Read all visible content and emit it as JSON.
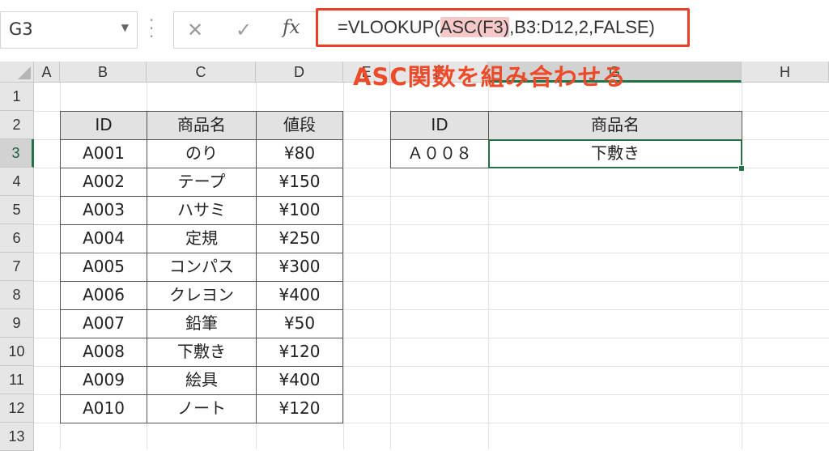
{
  "formula_bar": {
    "name_box": "G3",
    "cancel_icon": "close-icon",
    "enter_icon": "check-icon",
    "fx_label": "fx",
    "formula_prefix": "=VLOOKUP(",
    "formula_highlight": "ASC(F3)",
    "formula_suffix": ",B3:D12,2,FALSE)"
  },
  "annotation": "ASC関数を組み合わせる",
  "columns": [
    "A",
    "B",
    "C",
    "D",
    "E",
    "F",
    "G",
    "H"
  ],
  "rows": [
    "1",
    "2",
    "3",
    "4",
    "5",
    "6",
    "7",
    "8",
    "9",
    "10",
    "11",
    "12",
    "13"
  ],
  "product_table": {
    "headers": [
      "ID",
      "商品名",
      "値段"
    ],
    "rows": [
      [
        "A001",
        "のり",
        "¥80"
      ],
      [
        "A002",
        "テープ",
        "¥150"
      ],
      [
        "A003",
        "ハサミ",
        "¥100"
      ],
      [
        "A004",
        "定規",
        "¥250"
      ],
      [
        "A005",
        "コンパス",
        "¥300"
      ],
      [
        "A006",
        "クレヨン",
        "¥400"
      ],
      [
        "A007",
        "鉛筆",
        "¥50"
      ],
      [
        "A008",
        "下敷き",
        "¥120"
      ],
      [
        "A009",
        "絵具",
        "¥400"
      ],
      [
        "A010",
        "ノート",
        "¥120"
      ]
    ]
  },
  "lookup_table": {
    "headers": [
      "ID",
      "商品名"
    ],
    "id_value": "Ａ００８",
    "result_value": "下敷き"
  },
  "colors": {
    "accent": "#217346",
    "annotation": "#ec4a28",
    "formula_border": "#e8402a",
    "highlight": "#f6c8c8"
  }
}
